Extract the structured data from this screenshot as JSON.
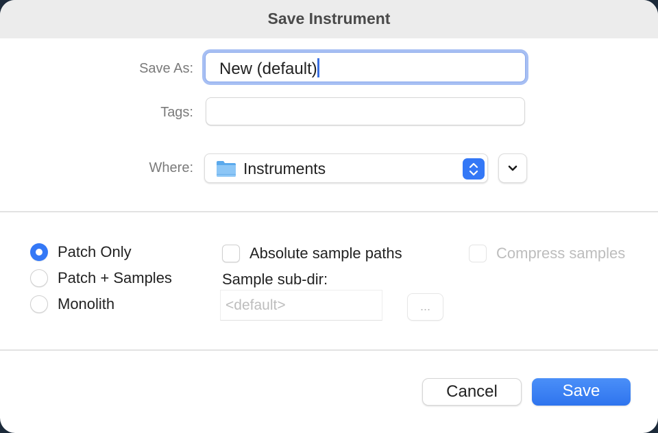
{
  "dialog": {
    "title": "Save Instrument"
  },
  "form": {
    "save_as_label": "Save As:",
    "save_as_value": "New (default)",
    "tags_label": "Tags:",
    "tags_value": "",
    "where_label": "Where:",
    "where_value": "Instruments",
    "where_icon": "folder-icon"
  },
  "options": {
    "save_mode": {
      "selected": "Patch Only",
      "items": [
        {
          "label": "Patch Only",
          "checked": true
        },
        {
          "label": "Patch + Samples",
          "checked": false
        },
        {
          "label": "Monolith",
          "checked": false
        }
      ]
    },
    "absolute_sample_paths": {
      "label": "Absolute sample paths",
      "checked": false,
      "enabled": true
    },
    "compress_samples": {
      "label": "Compress samples",
      "checked": false,
      "enabled": false
    },
    "sample_subdir": {
      "label": "Sample sub-dir:",
      "value": "",
      "placeholder": "<default>",
      "enabled": false
    },
    "browse_label": "..."
  },
  "buttons": {
    "cancel_label": "Cancel",
    "save_label": "Save"
  },
  "colors": {
    "accent": "#3478f6",
    "focus_ring": "#a7bff3",
    "titlebar": "#ececec"
  }
}
